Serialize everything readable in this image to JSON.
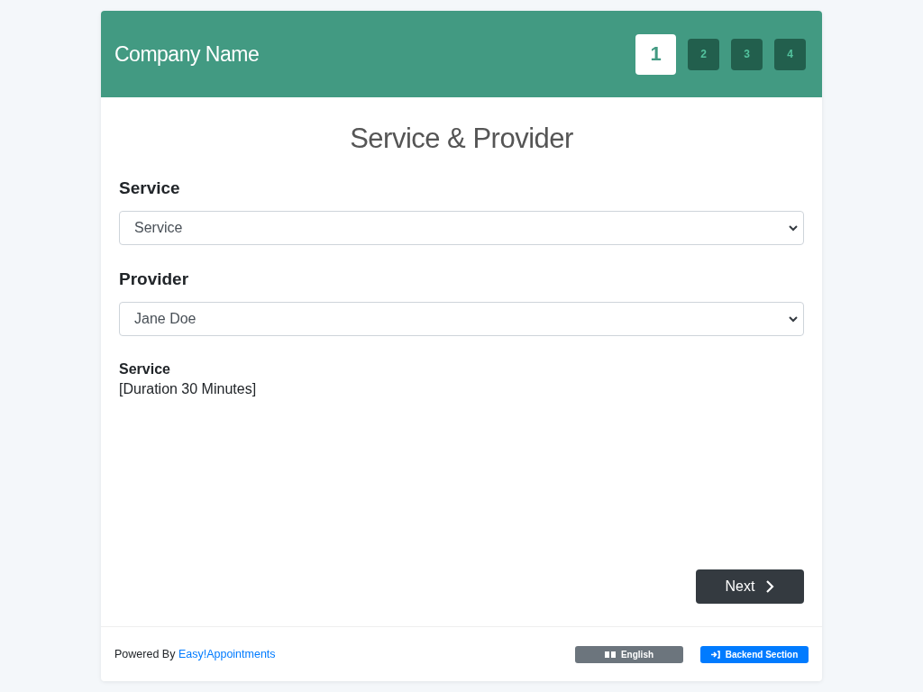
{
  "header": {
    "company_name": "Company Name",
    "steps": [
      {
        "label": "1",
        "selected": true
      },
      {
        "label": "2",
        "selected": false
      },
      {
        "label": "3",
        "selected": false
      },
      {
        "label": "4",
        "selected": false
      }
    ]
  },
  "title": "Service & Provider",
  "fields": [
    {
      "label": "Service",
      "value": "Service"
    },
    {
      "label": "Provider",
      "value": "Jane Doe"
    }
  ],
  "details": {
    "name": "Service",
    "duration": "[Duration 30 Minutes]"
  },
  "next_button": "Next",
  "footer": {
    "powered_by": "Powered By",
    "link": "Easy!Appointments",
    "language_button": "English",
    "backend_button": "Backend Section"
  }
}
